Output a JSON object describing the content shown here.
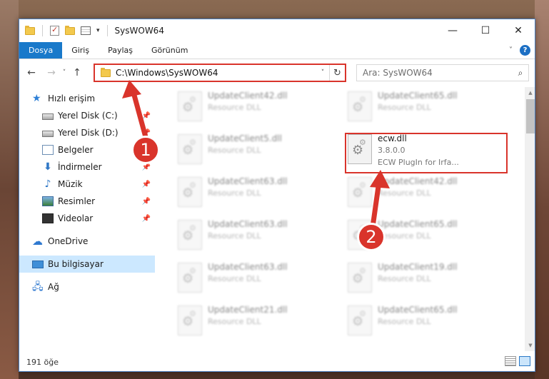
{
  "window": {
    "title": "SysWOW64",
    "controls": {
      "minimize": "—",
      "maximize": "☐",
      "close": "✕"
    }
  },
  "ribbon": {
    "tabs": [
      "Dosya",
      "Giriş",
      "Paylaş",
      "Görünüm"
    ],
    "active_tab": "Dosya",
    "help": "?"
  },
  "nav": {
    "back": "←",
    "forward": "→",
    "recent": "˅",
    "up": "↑",
    "address": "C:\\Windows\\SysWOW64",
    "address_dropdown": "˅",
    "refresh": "↻",
    "search_placeholder": "Ara: SysWOW64",
    "search_icon": "⌕"
  },
  "sidebar": {
    "items": [
      {
        "label": "Hızlı erişim",
        "icon": "star-icon",
        "pinned": false
      },
      {
        "label": "Yerel Disk (C:)",
        "icon": "disk-icon",
        "pinned": true
      },
      {
        "label": "Yerel Disk (D:)",
        "icon": "disk-icon",
        "pinned": true
      },
      {
        "label": "Belgeler",
        "icon": "documents-icon",
        "pinned": true
      },
      {
        "label": "İndirmeler",
        "icon": "download-icon",
        "pinned": true
      },
      {
        "label": "Müzik",
        "icon": "music-icon",
        "pinned": true
      },
      {
        "label": "Resimler",
        "icon": "pictures-icon",
        "pinned": true
      },
      {
        "label": "Videolar",
        "icon": "videos-icon",
        "pinned": true
      },
      {
        "label": "OneDrive",
        "icon": "cloud-icon",
        "pinned": false
      },
      {
        "label": "Bu bilgisayar",
        "icon": "computer-icon",
        "pinned": false
      },
      {
        "label": "Ağ",
        "icon": "network-icon",
        "pinned": false
      }
    ],
    "selected": "Bu bilgisayar",
    "pin_glyph": "📌"
  },
  "files": {
    "left_column": [
      {
        "name": "UpdateClient42.dll",
        "type": "Resource DLL"
      },
      {
        "name": "UpdateClient5.dll",
        "type": "Resource DLL"
      },
      {
        "name": "UpdateClient63.dll",
        "type": "Resource DLL"
      },
      {
        "name": "UpdateClient63.dll",
        "type": "Resource DLL"
      },
      {
        "name": "UpdateClient63.dll",
        "type": "Resource DLL"
      },
      {
        "name": "UpdateClient21.dll",
        "type": "Resource DLL"
      }
    ],
    "right_column": [
      {
        "name": "UpdateClient65.dll",
        "type": "Resource DLL"
      },
      {
        "name": "ecw.dll",
        "version": "3.8.0.0",
        "type": "ECW PlugIn for Irfa...",
        "highlighted": true
      },
      {
        "name": "UpdateClient42.dll",
        "type": "Resource DLL"
      },
      {
        "name": "UpdateClient65.dll",
        "type": "Resource DLL"
      },
      {
        "name": "UpdateClient19.dll",
        "type": "Resource DLL"
      },
      {
        "name": "UpdateClient65.dll",
        "type": "Resource DLL"
      }
    ]
  },
  "status": {
    "item_count": "191 öğe"
  },
  "annotations": [
    {
      "number": "1",
      "color": "#d9342b"
    },
    {
      "number": "2",
      "color": "#d9342b"
    }
  ],
  "colors": {
    "accent": "#1979ca",
    "annotation": "#d9342b",
    "selection": "#cce8ff"
  }
}
